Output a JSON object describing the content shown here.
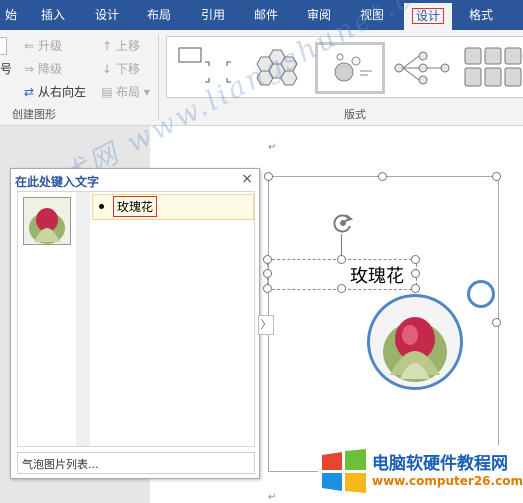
{
  "tabs": [
    {
      "label": "始",
      "active": false
    },
    {
      "label": "插入",
      "active": false
    },
    {
      "label": "设计",
      "active": false
    },
    {
      "label": "布局",
      "active": false
    },
    {
      "label": "引用",
      "active": false
    },
    {
      "label": "邮件",
      "active": false
    },
    {
      "label": "审阅",
      "active": false
    },
    {
      "label": "视图",
      "active": false
    },
    {
      "label": "设计",
      "active": true
    },
    {
      "label": "格式",
      "active": false
    }
  ],
  "ribbon": {
    "create_group": {
      "fragment_top": "号",
      "promote": "升级",
      "demote": "降级",
      "rtl": "从右向左",
      "move_up": "上移",
      "move_down": "下移",
      "layout": "布局",
      "group_label": "创建图形"
    },
    "layouts_group": {
      "group_label": "版式"
    }
  },
  "text_pane": {
    "title": "在此处键入文字",
    "close": "×",
    "item_text": "玫瑰花",
    "footer": "气泡图片列表...",
    "toggle": "〉"
  },
  "smartart": {
    "label": "玫瑰花",
    "accent_color": "#4f86c6"
  },
  "watermark": "亮术网 www.liangshunet.com",
  "logo": {
    "title": "电脑软硬件教程网",
    "url": "www.computer26.com"
  },
  "doc_marks": [
    "↵",
    "↵"
  ]
}
